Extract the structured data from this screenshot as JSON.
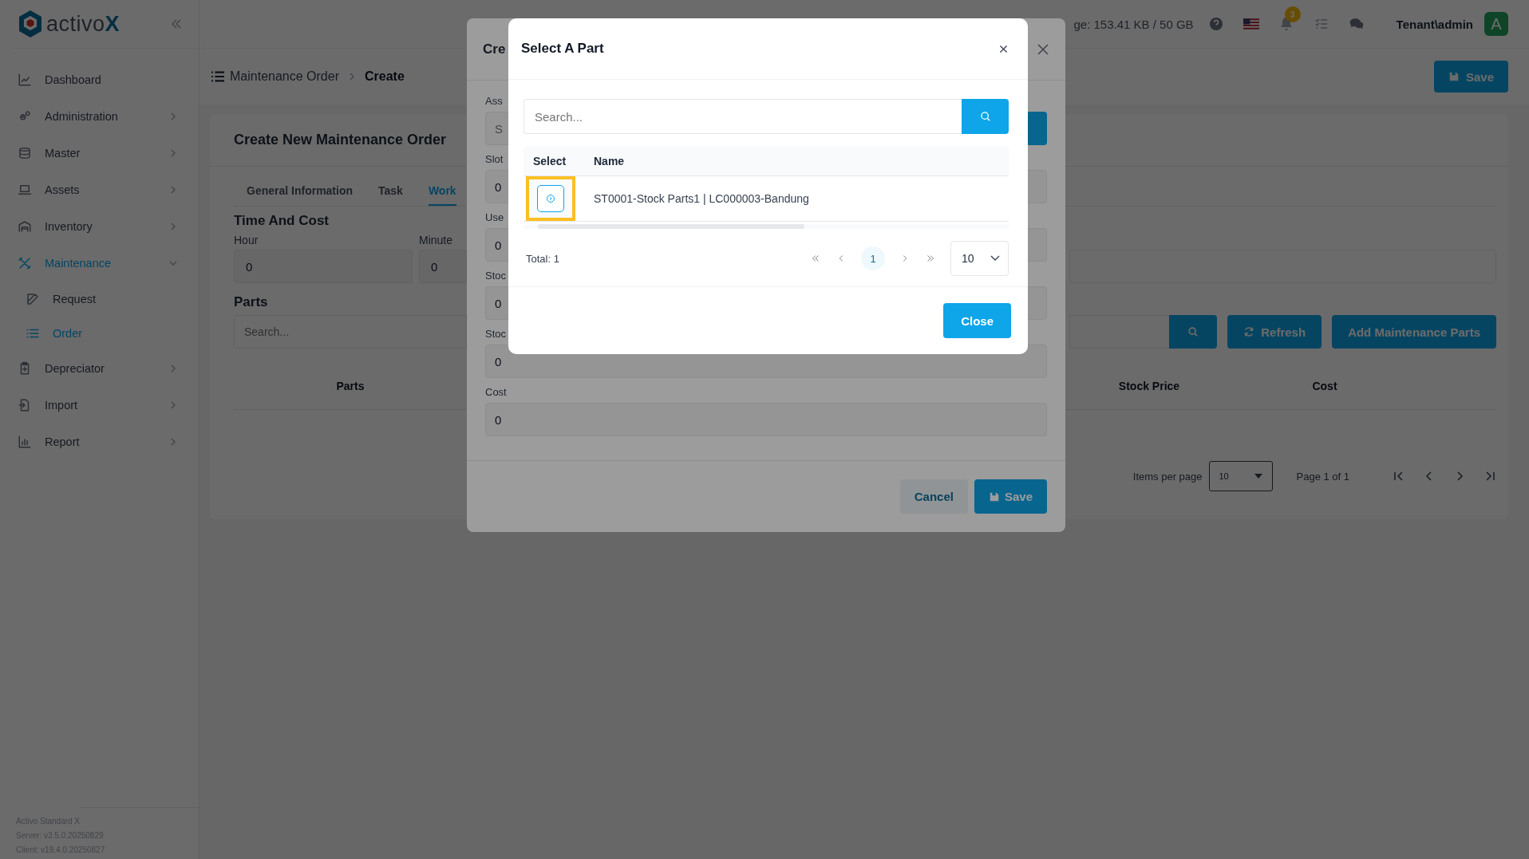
{
  "sidebar": {
    "brand": "activo",
    "brand_accent": "X",
    "items": [
      {
        "label": "Dashboard",
        "submenu": false,
        "selected": false
      },
      {
        "label": "Administration",
        "submenu": true,
        "expanded": false,
        "selected": false
      },
      {
        "label": "Master",
        "submenu": true,
        "expanded": false,
        "selected": false
      },
      {
        "label": "Assets",
        "submenu": true,
        "expanded": false,
        "selected": false
      },
      {
        "label": "Inventory",
        "submenu": true,
        "expanded": false,
        "selected": false
      },
      {
        "label": "Maintenance",
        "submenu": true,
        "expanded": true,
        "selected": true,
        "children": [
          {
            "label": "Request",
            "selected": false
          },
          {
            "label": "Order",
            "selected": true
          }
        ]
      },
      {
        "label": "Depreciator",
        "submenu": true,
        "expanded": false,
        "selected": false
      },
      {
        "label": "Import",
        "submenu": true,
        "expanded": false,
        "selected": false
      },
      {
        "label": "Report",
        "submenu": true,
        "expanded": false,
        "selected": false
      }
    ],
    "footer": [
      "Activo Standard X",
      "Server: v3.5.0.20250829",
      "Client: v19.4.0.20250827"
    ]
  },
  "topbar": {
    "storage": "ge: 153.41 KB / 50 GB",
    "notifications": "3",
    "user": "Tenant\\admin",
    "avatar": "A"
  },
  "breadcrumb": [
    "Maintenance Order",
    "Create"
  ],
  "save_button": "Save",
  "form": {
    "title": "Create New Maintenance Order",
    "tabs": [
      {
        "label": "General Information",
        "selected": false
      },
      {
        "label": "Task",
        "selected": false
      },
      {
        "label": "Work",
        "selected": true
      }
    ],
    "section": "Time And Cost",
    "fields": [
      {
        "label": "Hour",
        "value": "0"
      },
      {
        "label": "Minute",
        "value": "0"
      }
    ],
    "parts_heading": "Parts",
    "search": {
      "placeholder": "Search..."
    },
    "buttons": [
      "Refresh",
      "Add Maintenance Parts"
    ],
    "columns": [
      "Parts",
      "Stock Price",
      "Cost"
    ],
    "pagination": {
      "label": "Items per page",
      "per_page": "10",
      "page_info": "Page 1 of 1"
    }
  },
  "order_dialog": {
    "title": "Cre",
    "fields": [
      {
        "label": "Ass",
        "placeholder": "S",
        "lookup": true
      },
      {
        "label": "Slot",
        "value": "0",
        "lookup": false
      },
      {
        "label": "Use",
        "value": "0",
        "lookup": false
      },
      {
        "label": "Stoc",
        "value": "0",
        "lookup": false
      },
      {
        "label": "Stoc",
        "value": "0",
        "lookup": false
      },
      {
        "label": "Cost",
        "value": "0",
        "lookup": false
      }
    ],
    "buttons": [
      "Cancel",
      "Save"
    ]
  },
  "part_dialog": {
    "title": "Select A Part",
    "search": {
      "placeholder": "Search..."
    },
    "columns": [
      "Select",
      "Name"
    ],
    "rows": [
      {
        "name": "ST0001-Stock Parts1 | LC000003-Bandung",
        "highlighted": true
      }
    ],
    "total": "Total: 1",
    "pages": [
      {
        "label": "1",
        "selected": true
      }
    ],
    "per_page": "10",
    "close_button": "Close"
  }
}
